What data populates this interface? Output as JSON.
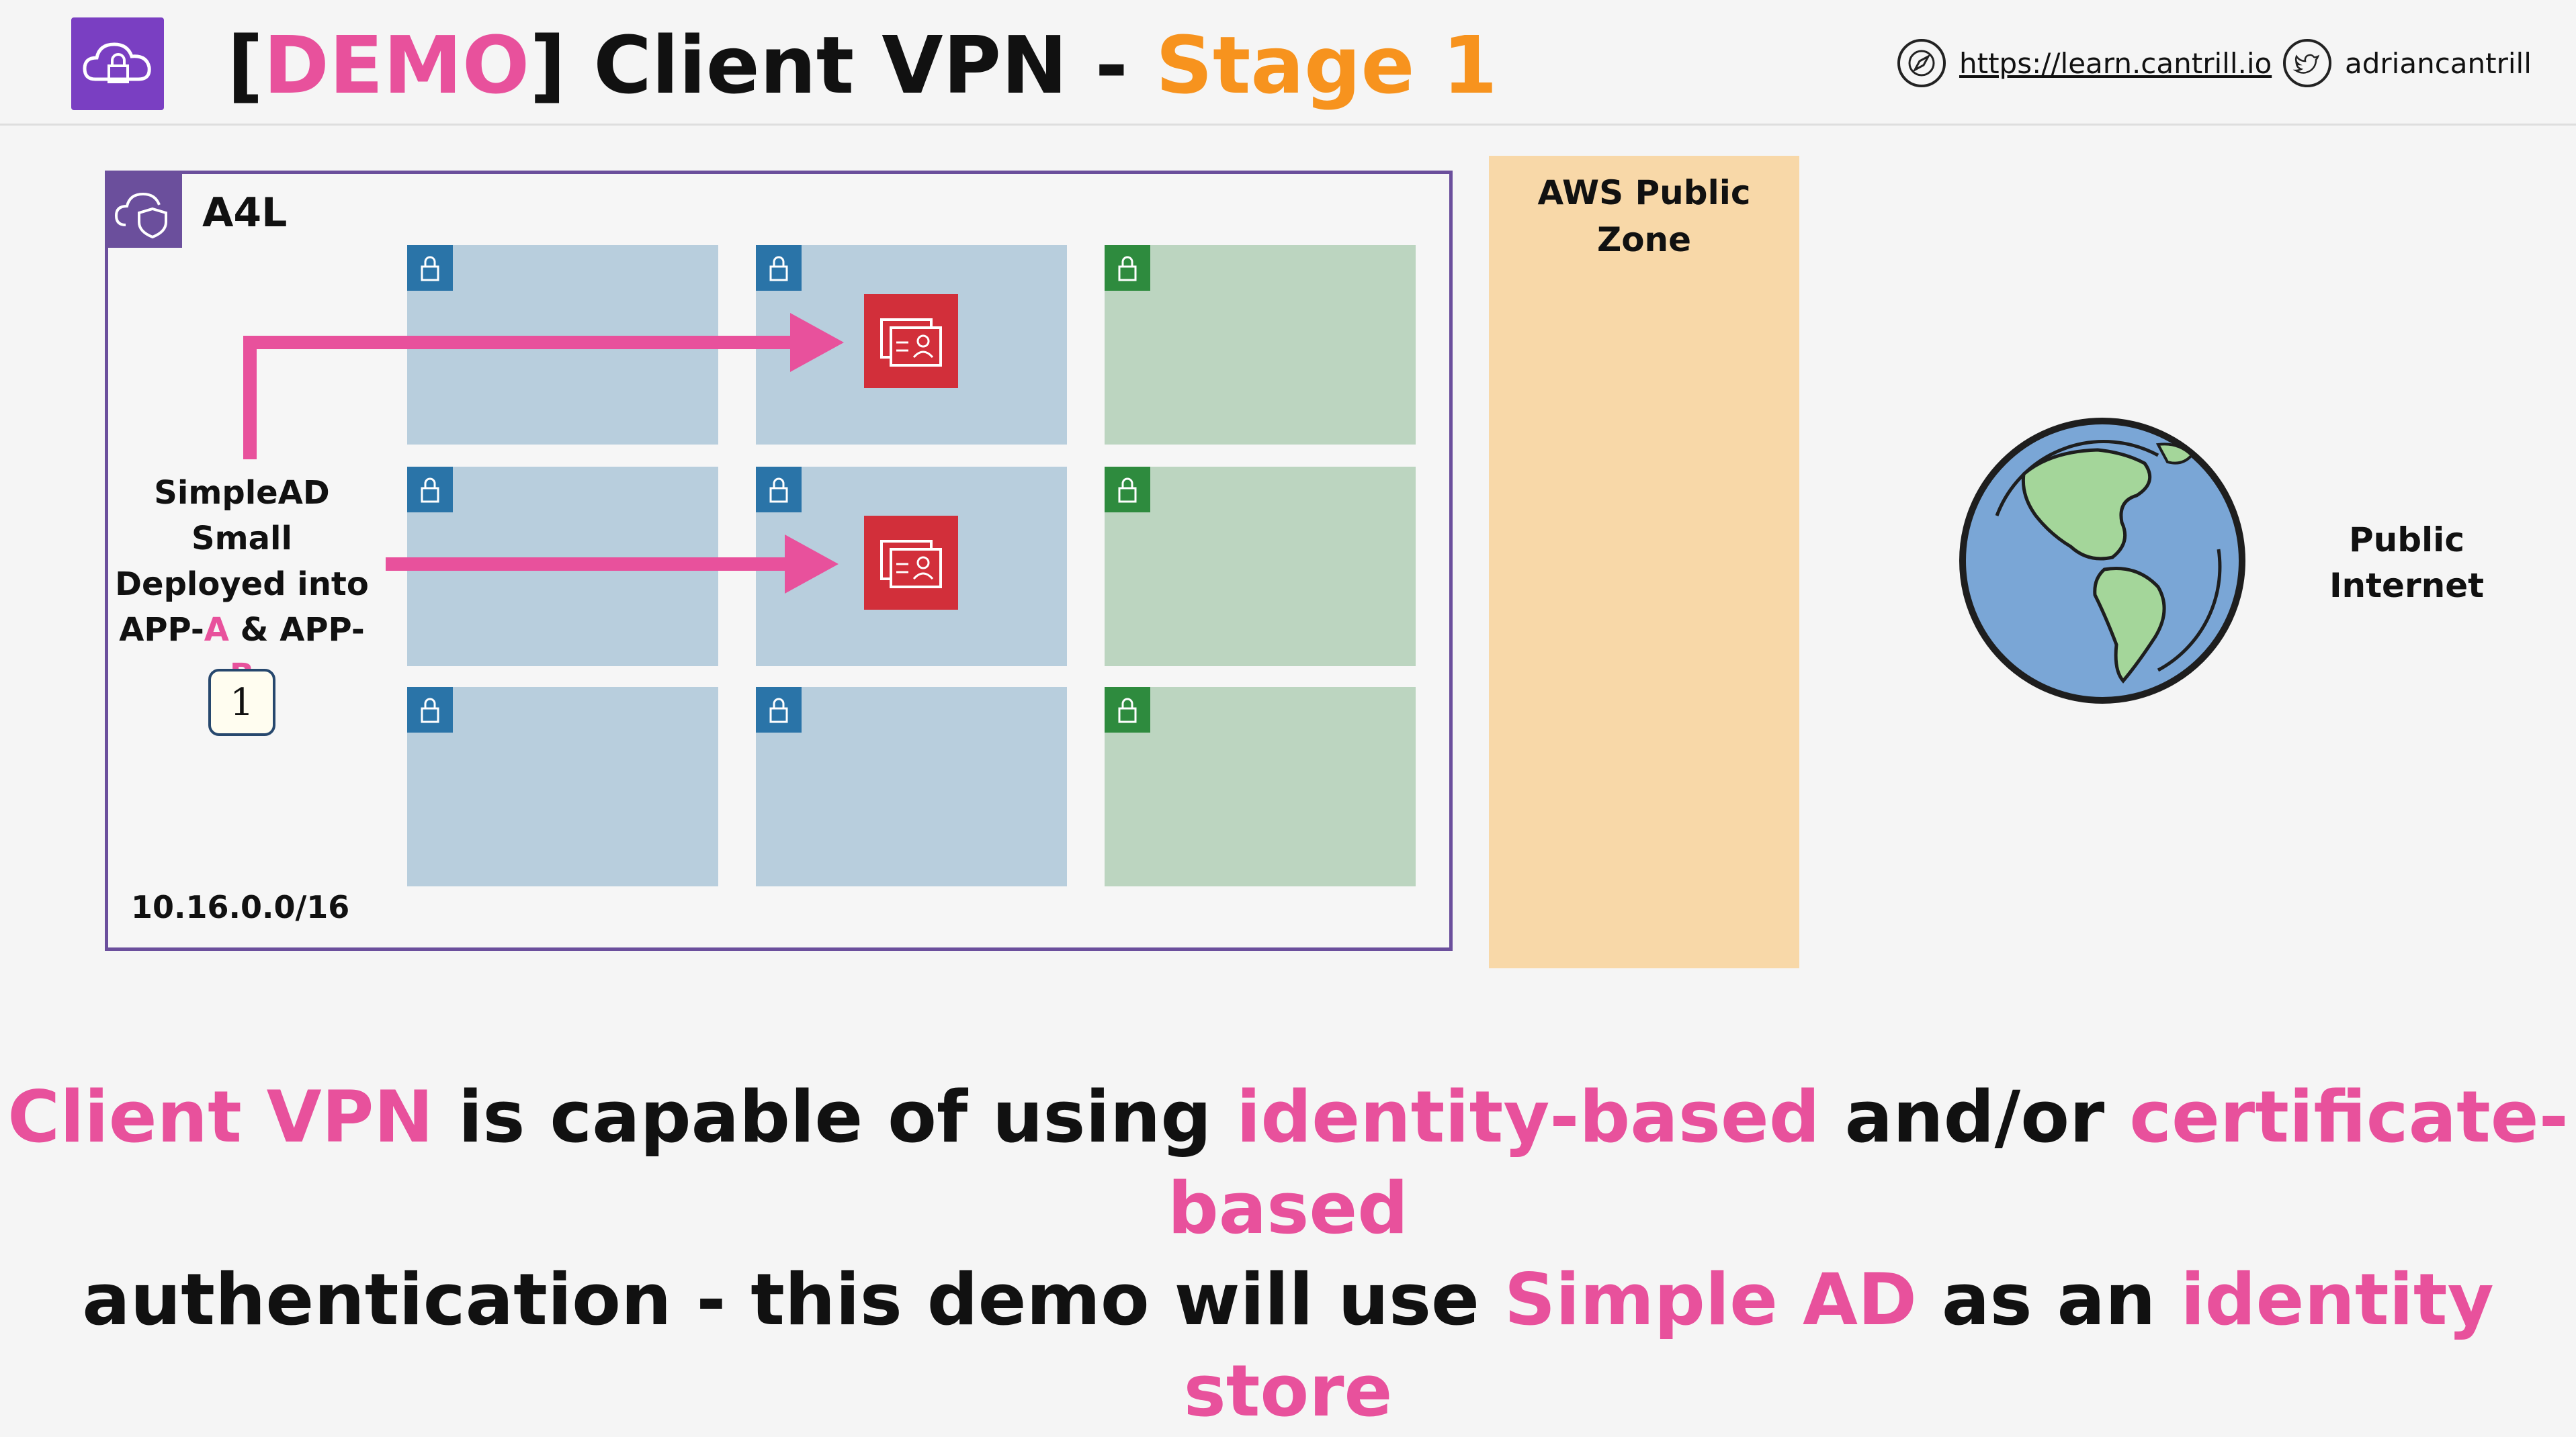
{
  "header": {
    "title_bracket_open": "[",
    "title_demo": "DEMO",
    "title_bracket_close": "]",
    "title_main": " Client VPN - ",
    "title_stage": "Stage 1",
    "website_url": "https://learn.cantrill.io",
    "twitter_handle": "adriancantrill",
    "logo_icon": "cloud-lock-icon",
    "website_icon": "compass-icon",
    "twitter_icon": "twitter-bird-icon"
  },
  "vpc": {
    "name": "A4L",
    "cidr": "10.16.0.0/16",
    "badge_icon": "cloud-shield-icon",
    "subnet_icon": "lock-icon"
  },
  "annotation": {
    "line1": "SimpleAD",
    "line2": "Small",
    "line3": "Deployed into",
    "line4_a": "APP-",
    "line4_b": "A",
    "line4_c": " & APP-",
    "line4_d": "B",
    "step": "1"
  },
  "zone": {
    "label": "AWS Public Zone"
  },
  "internet": {
    "line1": "Public",
    "line2": "Internet",
    "icon": "globe-icon"
  },
  "directory_icon": "directory-service-icon",
  "bottom_text": {
    "l1_a": "Client VPN",
    "l1_b": " is capable of using ",
    "l1_c": "identity-based",
    "l1_d": " and/or ",
    "l1_e": "certificate-based",
    "l2_a": "authentication - this demo will use ",
    "l2_b": "Simple AD",
    "l2_c": " as an ",
    "l2_d": "identity store"
  },
  "colors": {
    "pink": "#e8519c",
    "orange": "#f7931e",
    "vpc_purple": "#6b4f9c",
    "private_subnet": "#b8cedd",
    "public_subnet": "#bcd5c0",
    "zone": "#f8d8a8",
    "arrow": "#e8519c"
  }
}
